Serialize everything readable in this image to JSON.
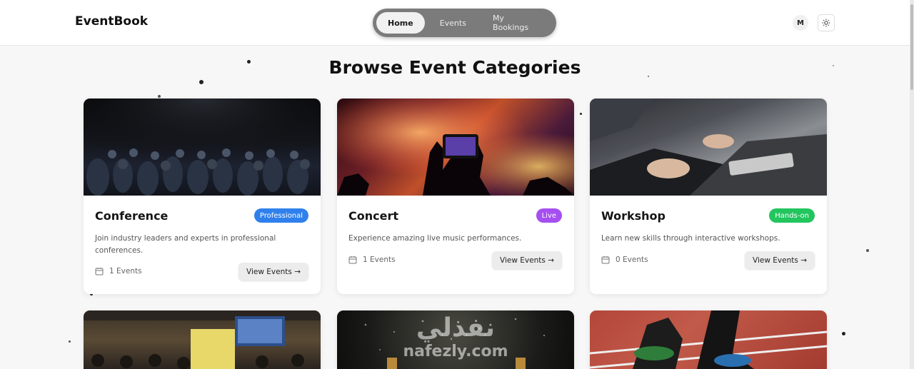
{
  "header": {
    "logo": "EventBook",
    "nav": [
      {
        "label": "Home",
        "active": true
      },
      {
        "label": "Events",
        "active": false
      },
      {
        "label": "My Bookings",
        "active": false
      }
    ],
    "avatar_initial": "M",
    "theme_icon": "sun-icon"
  },
  "page": {
    "title": "Browse Event Categories"
  },
  "categories": [
    {
      "title": "Conference",
      "badge": "Professional",
      "badge_color": "#2f80ed",
      "description": "Join industry leaders and experts in professional conferences.",
      "count": "1 Events",
      "button": "View Events →"
    },
    {
      "title": "Concert",
      "badge": "Live",
      "badge_color": "#a64ff0",
      "description": "Experience amazing live music performances.",
      "count": "1 Events",
      "button": "View Events →"
    },
    {
      "title": "Workshop",
      "badge": "Hands-on",
      "badge_color": "#22c55e",
      "description": "Learn new skills through interactive workshops.",
      "count": "0 Events",
      "button": "View Events →"
    }
  ],
  "watermark": {
    "arabic": "نفذلي",
    "latin": "nafezly.com"
  }
}
